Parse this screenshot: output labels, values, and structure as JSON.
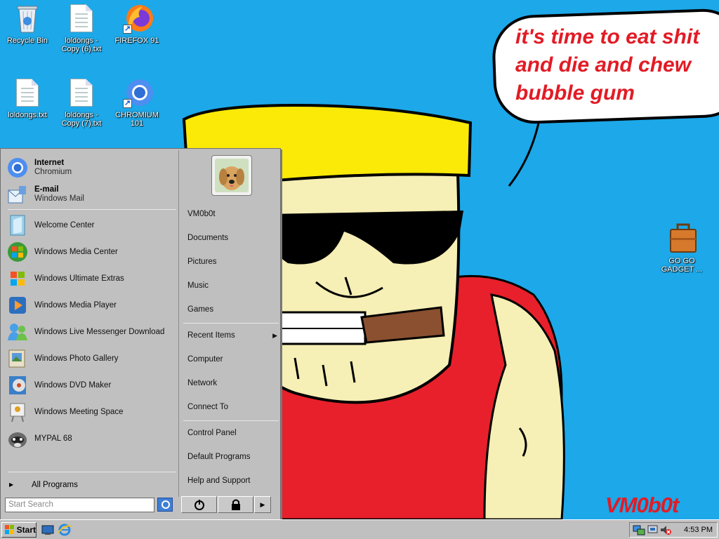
{
  "desktop": {
    "icons": [
      {
        "label": "Recycle Bin",
        "icon": "recycle-bin-icon"
      },
      {
        "label": "loldongs - Copy (6).txt",
        "icon": "text-file-icon"
      },
      {
        "label": "FIREFOX 91",
        "icon": "firefox-icon"
      },
      {
        "label": "loldongs.txt",
        "icon": "text-file-icon"
      },
      {
        "label": "loldongs - Copy (7).txt",
        "icon": "text-file-icon"
      },
      {
        "label": "CHROMIUM 101",
        "icon": "chromium-icon"
      },
      {
        "label": "GO GO GADGET ...",
        "icon": "briefcase-icon"
      }
    ],
    "wallpaper": {
      "speech_text": "it's time to eat shit\nand die and chew\nbubble gum",
      "signature": "VM0b0t",
      "text_color": "#e21b25",
      "background": "#1ca8e9"
    }
  },
  "start_menu": {
    "pinned": [
      {
        "title": "Internet",
        "subtitle": "Chromium",
        "icon": "chromium-icon"
      },
      {
        "title": "E-mail",
        "subtitle": "Windows Mail",
        "icon": "windows-mail-icon"
      }
    ],
    "recent_programs": [
      {
        "label": "Welcome Center",
        "icon": "welcome-center-icon"
      },
      {
        "label": "Windows Media Center",
        "icon": "media-center-icon"
      },
      {
        "label": "Windows Ultimate Extras",
        "icon": "ultimate-extras-icon"
      },
      {
        "label": "Windows Media Player",
        "icon": "media-player-icon"
      },
      {
        "label": "Windows Live Messenger Download",
        "icon": "messenger-icon"
      },
      {
        "label": "Windows Photo Gallery",
        "icon": "photo-gallery-icon"
      },
      {
        "label": "Windows DVD Maker",
        "icon": "dvd-maker-icon"
      },
      {
        "label": "Windows Meeting Space",
        "icon": "meeting-space-icon"
      },
      {
        "label": "MYPAL 68",
        "icon": "mypal-icon"
      }
    ],
    "all_programs": "All Programs",
    "search_placeholder": "Start Search",
    "right_items_group1": [
      "VM0b0t",
      "Documents",
      "Pictures",
      "Music",
      "Games"
    ],
    "right_items_group2": [
      "Recent Items",
      "Computer",
      "Network",
      "Connect To"
    ],
    "right_items_group3": [
      "Control Panel",
      "Default Programs",
      "Help and Support"
    ]
  },
  "taskbar": {
    "start_label": "Start",
    "clock": "4:53 PM"
  }
}
